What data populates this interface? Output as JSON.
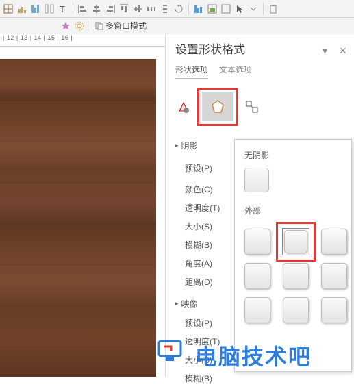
{
  "toolbar": {
    "icons": [
      "table",
      "chart-bar",
      "chart-col",
      "chart-line",
      "text-tool",
      "align-left",
      "align-center",
      "align-right",
      "align-top",
      "align-middle",
      "distribute-h",
      "distribute-v",
      "wrap",
      "chart-bar2",
      "chart-area",
      "chart-combo",
      "pointer",
      "dropdown",
      "clipboard"
    ]
  },
  "secondbar": {
    "multiwindow": "多窗口模式",
    "star": "star-icon",
    "gear": "gear-icon",
    "doc": "doc-icon"
  },
  "ruler": "| 12 | 13 | 14 | 15 | 16 |",
  "panel": {
    "title": "设置形状格式",
    "tabs": {
      "shape": "形状选项",
      "text": "文本选项"
    },
    "sections": {
      "shadow": "阴影",
      "reflection": "映像"
    },
    "rows": {
      "preset": "预设(P)",
      "color": "颜色(C)",
      "transparency": "透明度(T)",
      "size": "大小(S)",
      "blur": "模糊(B)",
      "angle": "角度(A)",
      "distance": "距离(D)",
      "preset2": "预设(P)",
      "transparency2": "透明度(T)",
      "size2": "大小(S)",
      "blur2": "模糊(B)"
    }
  },
  "flyout": {
    "none": "无阴影",
    "outer": "外部"
  },
  "watermark": "电脑技术吧"
}
